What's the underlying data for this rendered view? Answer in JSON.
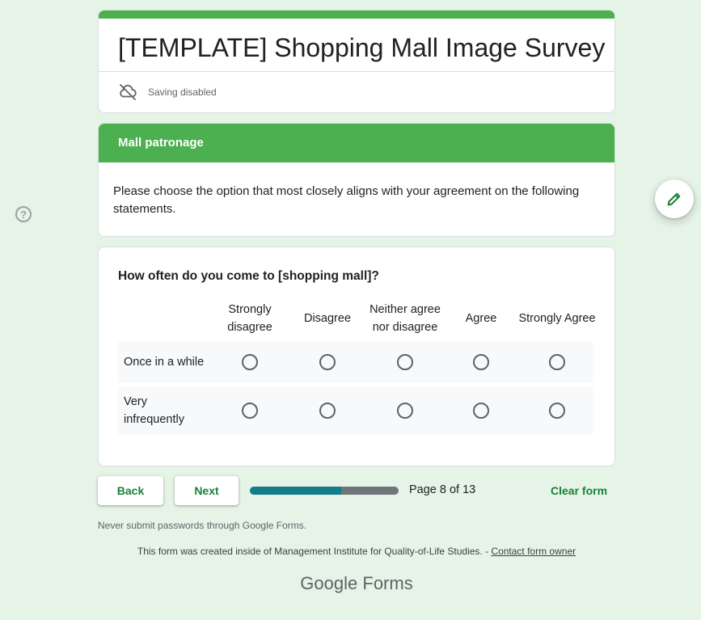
{
  "form": {
    "title": "[TEMPLATE] Shopping Mall Image Survey",
    "saving_text": "Saving disabled",
    "accent_color": "#4caf50"
  },
  "section": {
    "title": "Mall patronage",
    "description": "Please choose the option that most closely aligns with your agreement on the following statements."
  },
  "question": {
    "title": "How often do you come to [shopping mall]?",
    "columns": [
      "Strongly disagree",
      "Disagree",
      "Neither agree nor disagree",
      "Agree",
      "Strongly Agree"
    ],
    "rows": [
      "Once in a while",
      "Very infrequently"
    ]
  },
  "nav": {
    "back_label": "Back",
    "next_label": "Next",
    "page_text": "Page 8 of 13",
    "progress": 0.615,
    "clear_label": "Clear form"
  },
  "footer": {
    "note": "Never submit passwords through Google Forms.",
    "created_text": "This form was created inside of Management Institute for Quality-of-Life Studies. - ",
    "contact_link": "Contact form owner",
    "brand_google": "Google",
    "brand_forms": "Forms"
  },
  "icons": {
    "help": "help-icon",
    "edit": "pencil-icon",
    "cloud": "cloud-off-icon"
  }
}
